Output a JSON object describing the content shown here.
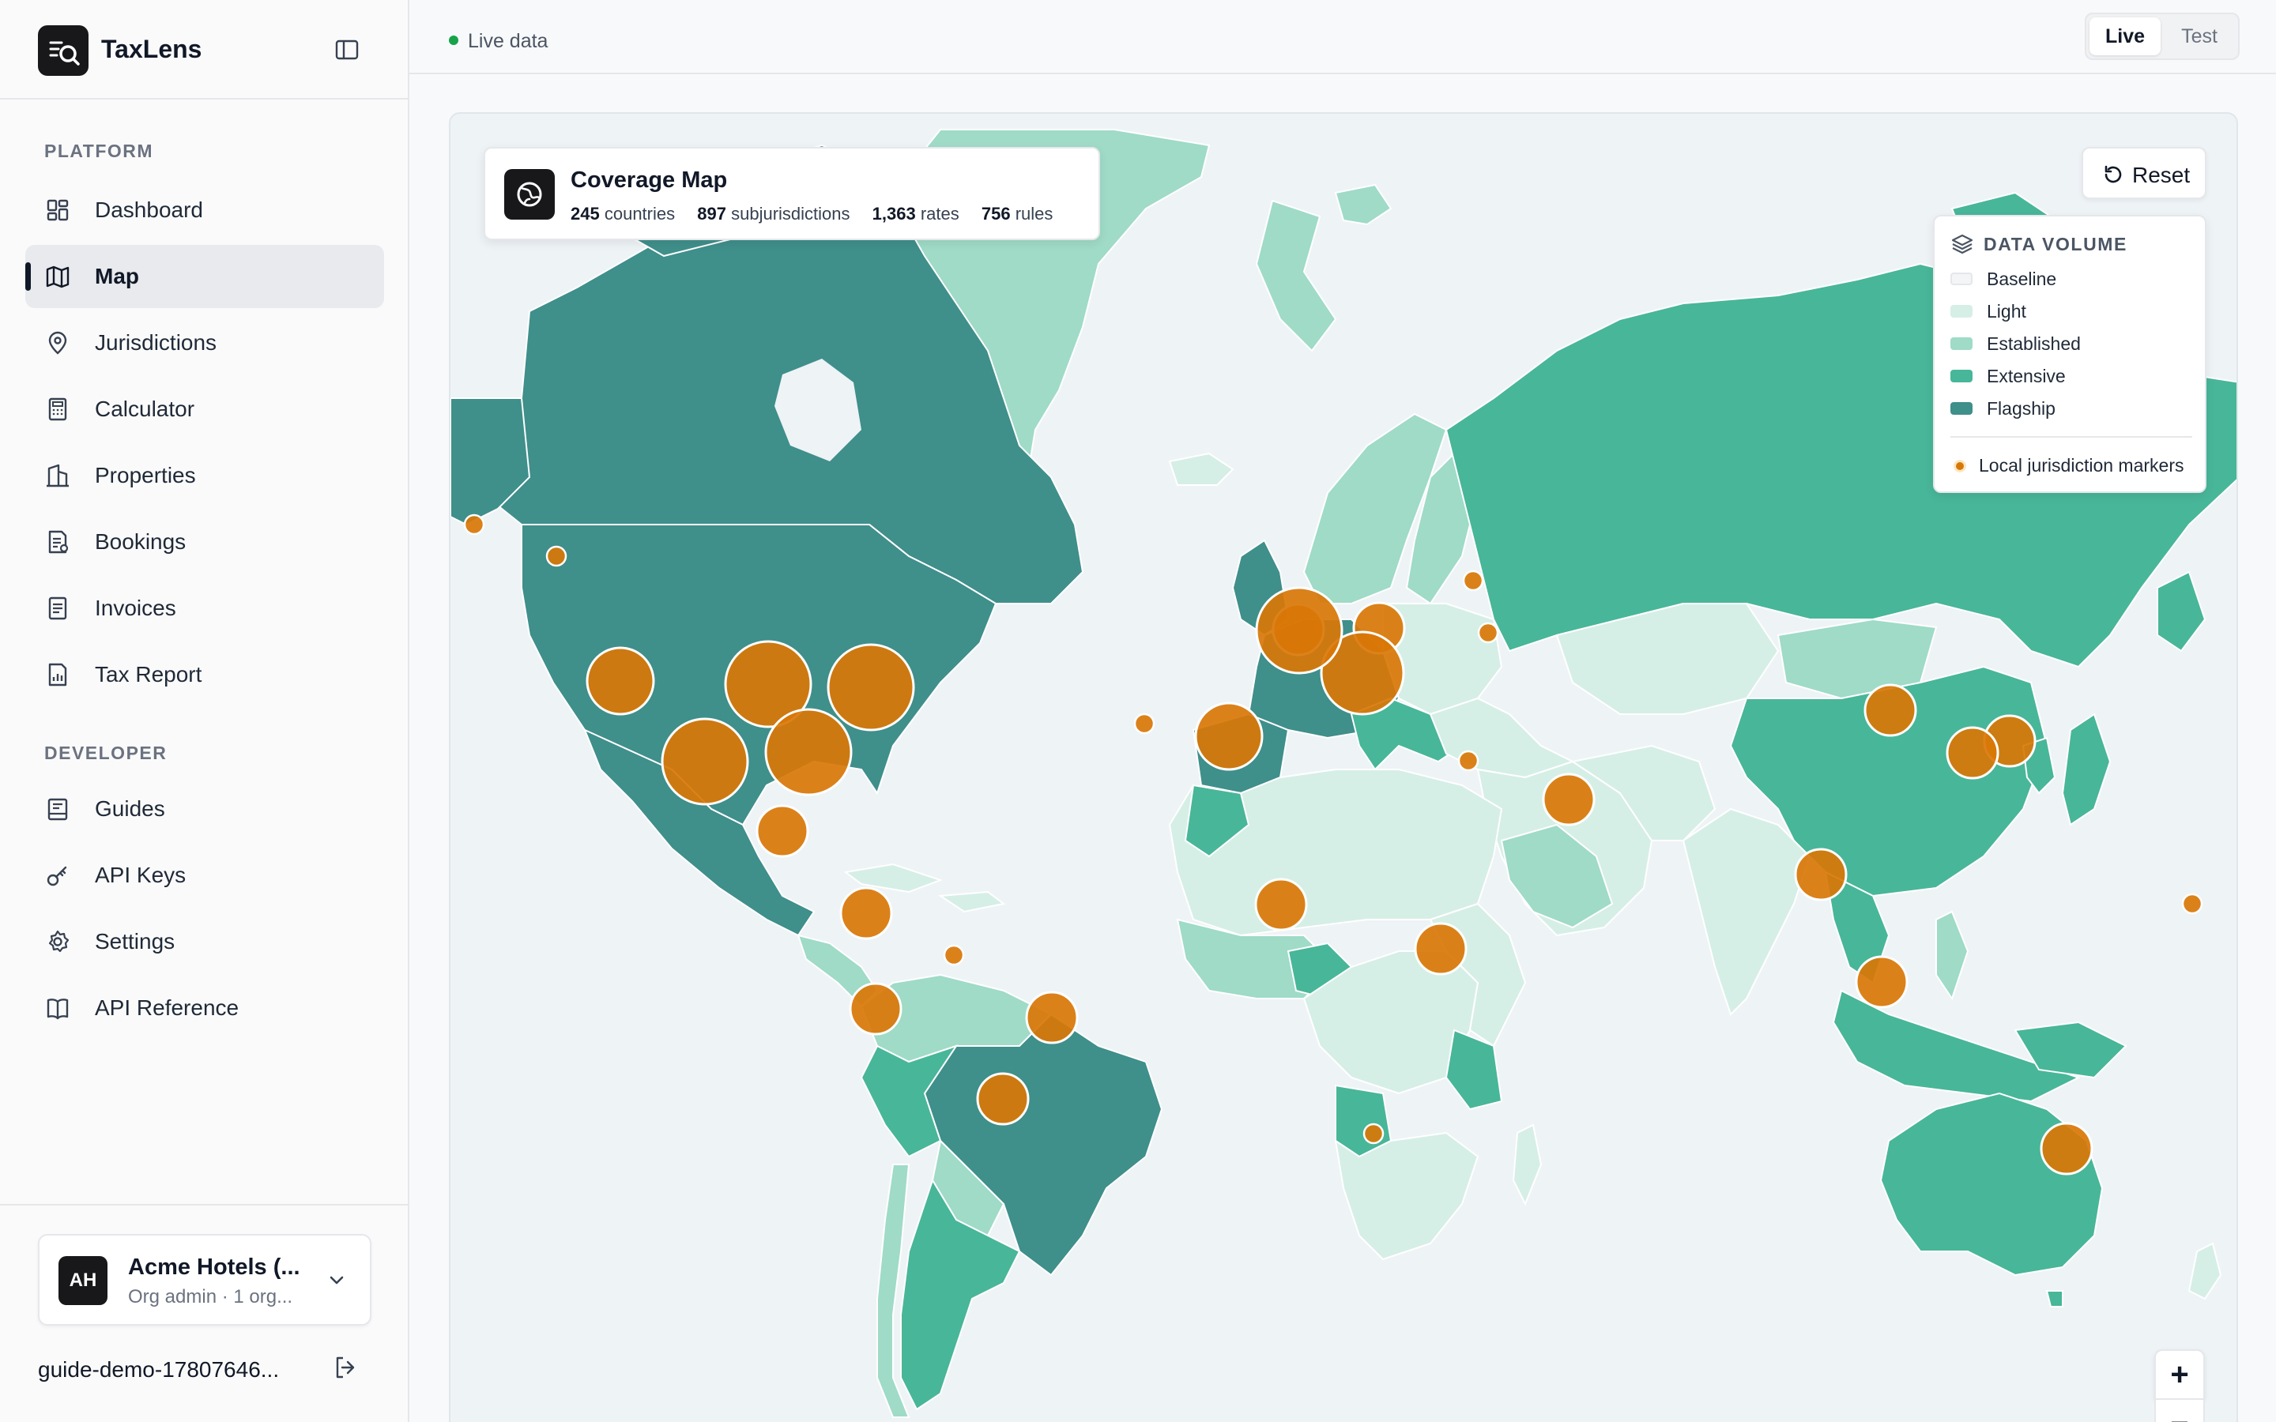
{
  "app": {
    "name": "TaxLens"
  },
  "sidebar": {
    "sections": [
      {
        "title": "PLATFORM"
      },
      {
        "title": "DEVELOPER"
      }
    ],
    "items": [
      {
        "label": "Dashboard",
        "icon": "dashboard-icon"
      },
      {
        "label": "Map",
        "icon": "map-icon",
        "active": true
      },
      {
        "label": "Jurisdictions",
        "icon": "map-pin-icon"
      },
      {
        "label": "Calculator",
        "icon": "calculator-icon"
      },
      {
        "label": "Properties",
        "icon": "building-icon"
      },
      {
        "label": "Bookings",
        "icon": "bookings-icon"
      },
      {
        "label": "Invoices",
        "icon": "invoice-icon"
      },
      {
        "label": "Tax Report",
        "icon": "report-icon"
      },
      {
        "label": "Guides",
        "icon": "guides-icon"
      },
      {
        "label": "API Keys",
        "icon": "key-icon"
      },
      {
        "label": "Settings",
        "icon": "gear-icon"
      },
      {
        "label": "API Reference",
        "icon": "book-icon"
      }
    ],
    "org": {
      "initials": "AH",
      "name": "Acme Hotels (...",
      "role": "Org admin · 1 org..."
    },
    "user_email": "guide-demo-17807646..."
  },
  "topbar": {
    "status": "Live data",
    "modes": [
      "Live",
      "Test"
    ],
    "active_mode": "Live"
  },
  "map": {
    "info": {
      "title": "Coverage Map",
      "countries_count": "245",
      "countries_label": "countries",
      "subjurisdictions_count": "897",
      "subjurisdictions_label": "subjurisdictions",
      "rates_count": "1,363",
      "rates_label": "rates",
      "rules_count": "756",
      "rules_label": "rules"
    },
    "reset_label": "Reset",
    "legend": {
      "title": "DATA VOLUME",
      "items": [
        {
          "label": "Baseline",
          "color": "#f3f5f6"
        },
        {
          "label": "Light",
          "color": "#d6efe6"
        },
        {
          "label": "Established",
          "color": "#9fdbc7"
        },
        {
          "label": "Extensive",
          "color": "#48b699"
        },
        {
          "label": "Flagship",
          "color": "#3f8f8b"
        }
      ],
      "marker_label": "Local jurisdiction markers",
      "marker_color": "#d97706"
    },
    "zoom_in_label": "+",
    "zoom_out_label": "−",
    "colors": {
      "ocean": "#eef3f6",
      "marker_fill": "#d97706",
      "marker_stroke": "#ffffff"
    }
  }
}
